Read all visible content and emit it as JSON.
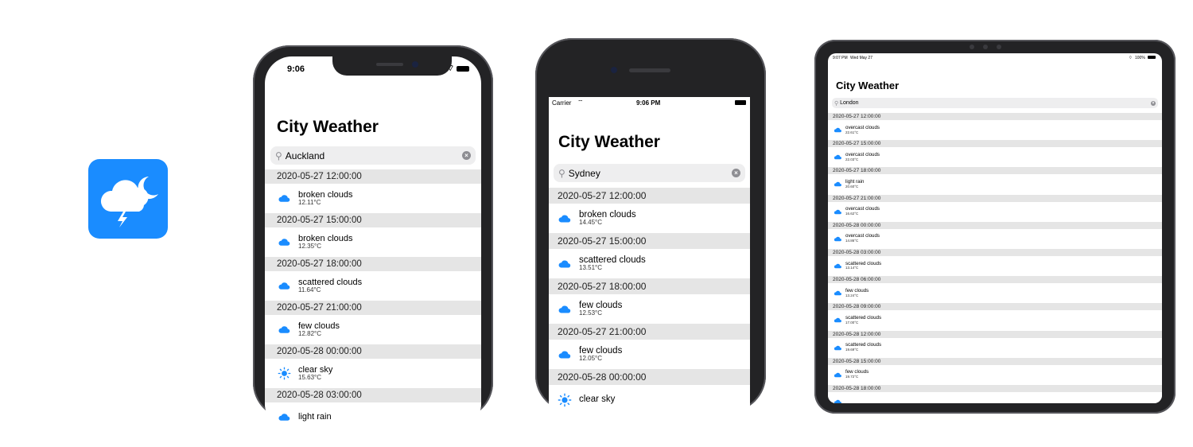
{
  "phones": [
    {
      "status_time": "9:06",
      "title": "City Weather",
      "search_value": "Auckland",
      "entries": [
        {
          "time": "2020-05-27 12:00:00",
          "description": "broken clouds",
          "temp": "12.11°C",
          "icon": "cloud-icon"
        },
        {
          "time": "2020-05-27 15:00:00",
          "description": "broken clouds",
          "temp": "12.35°C",
          "icon": "cloud-icon"
        },
        {
          "time": "2020-05-27 18:00:00",
          "description": "scattered clouds",
          "temp": "11.64°C",
          "icon": "cloud-icon"
        },
        {
          "time": "2020-05-27 21:00:00",
          "description": "few clouds",
          "temp": "12.82°C",
          "icon": "cloud-icon"
        },
        {
          "time": "2020-05-28 00:00:00",
          "description": "clear sky",
          "temp": "15.63°C",
          "icon": "sun-icon"
        },
        {
          "time": "2020-05-28 03:00:00",
          "description": "light rain",
          "temp": "",
          "icon": "cloud-icon"
        }
      ]
    },
    {
      "status_carrier": "Carrier",
      "status_time": "9:06 PM",
      "title": "City Weather",
      "search_value": "Sydney",
      "entries": [
        {
          "time": "2020-05-27 12:00:00",
          "description": "broken clouds",
          "temp": "14.45°C",
          "icon": "cloud-icon"
        },
        {
          "time": "2020-05-27 15:00:00",
          "description": "scattered clouds",
          "temp": "13.51°C",
          "icon": "cloud-icon"
        },
        {
          "time": "2020-05-27 18:00:00",
          "description": "few clouds",
          "temp": "12.53°C",
          "icon": "cloud-icon"
        },
        {
          "time": "2020-05-27 21:00:00",
          "description": "few clouds",
          "temp": "12.05°C",
          "icon": "cloud-icon"
        },
        {
          "time": "2020-05-28 00:00:00",
          "description": "clear sky",
          "temp": "",
          "icon": "sun-icon"
        }
      ]
    }
  ],
  "tablet": {
    "status_time": "9:07 PM",
    "status_date": "Wed May 27",
    "battery": "100%",
    "title": "City Weather",
    "search_value": "London",
    "entries": [
      {
        "time": "2020-05-27 12:00:00",
        "description": "overcast clouds",
        "temp": "22.61°C",
        "icon": "cloud-icon"
      },
      {
        "time": "2020-05-27 15:00:00",
        "description": "overcast clouds",
        "temp": "22.03°C",
        "icon": "cloud-icon"
      },
      {
        "time": "2020-05-27 18:00:00",
        "description": "light rain",
        "temp": "20.60°C",
        "icon": "cloud-icon"
      },
      {
        "time": "2020-05-27 21:00:00",
        "description": "overcast clouds",
        "temp": "16.62°C",
        "icon": "cloud-icon"
      },
      {
        "time": "2020-05-28 00:00:00",
        "description": "overcast clouds",
        "temp": "14.86°C",
        "icon": "cloud-icon"
      },
      {
        "time": "2020-05-28 03:00:00",
        "description": "scattered clouds",
        "temp": "13.14°C",
        "icon": "cloud-icon"
      },
      {
        "time": "2020-05-28 06:00:00",
        "description": "few clouds",
        "temp": "13.24°C",
        "icon": "cloud-icon"
      },
      {
        "time": "2020-05-28 09:00:00",
        "description": "scattered clouds",
        "temp": "17.00°C",
        "icon": "cloud-icon"
      },
      {
        "time": "2020-05-28 12:00:00",
        "description": "scattered clouds",
        "temp": "19.69°C",
        "icon": "cloud-icon"
      },
      {
        "time": "2020-05-28 15:00:00",
        "description": "few clouds",
        "temp": "19.72°C",
        "icon": "cloud-icon"
      },
      {
        "time": "2020-05-28 18:00:00",
        "description": "",
        "temp": "",
        "icon": "cloud-icon"
      }
    ]
  },
  "colors": {
    "accent": "#1a8cff",
    "section_bg": "#e5e5e5",
    "search_bg": "#eeeeef"
  }
}
